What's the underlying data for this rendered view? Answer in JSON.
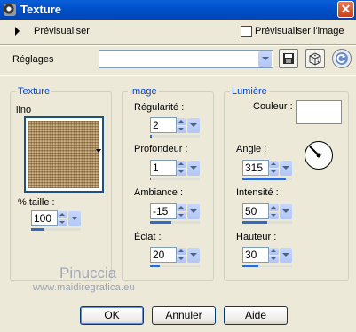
{
  "window": {
    "title": "Texture",
    "close_glyph": "✕"
  },
  "preview": {
    "label": "Prévisualiser",
    "checkbox_label": "Prévisualiser l'image",
    "checked": false
  },
  "presets": {
    "label": "Réglages",
    "value": ""
  },
  "toolbar_icons": [
    "save-icon",
    "dice-icon",
    "reset-icon"
  ],
  "texture_group": {
    "legend": "Texture",
    "texture_name": "lino",
    "size_label": "% taille :",
    "size_value": "100",
    "size_fraction": 0.25
  },
  "image_group": {
    "legend": "Image",
    "fields": [
      {
        "label": "Régularité :",
        "value": "2",
        "fraction": 0.04
      },
      {
        "label": "Profondeur :",
        "value": "1",
        "fraction": 0.02
      },
      {
        "label": "Ambiance :",
        "value": "-15",
        "fraction": 0.42
      },
      {
        "label": "Éclat :",
        "value": "20",
        "fraction": 0.2
      }
    ]
  },
  "light_group": {
    "legend": "Lumière",
    "color_label": "Couleur :",
    "color": "#ffffff",
    "fields": [
      {
        "label": "Angle :",
        "value": "315",
        "fraction": 0.875
      },
      {
        "label": "Intensité :",
        "value": "50",
        "fraction": 0.5
      },
      {
        "label": "Hauteur :",
        "value": "30",
        "fraction": 0.33
      }
    ]
  },
  "watermark": {
    "name": "Pinuccia",
    "site": "www.maidiregrafica.eu"
  },
  "buttons": {
    "ok": "OK",
    "cancel": "Annuler",
    "help": "Aide"
  },
  "colors": {
    "titlebar": "#0052cc",
    "dialog_bg": "#ece9d8",
    "group_legend": "#0046d5",
    "slider_fill": "#316ac5"
  }
}
